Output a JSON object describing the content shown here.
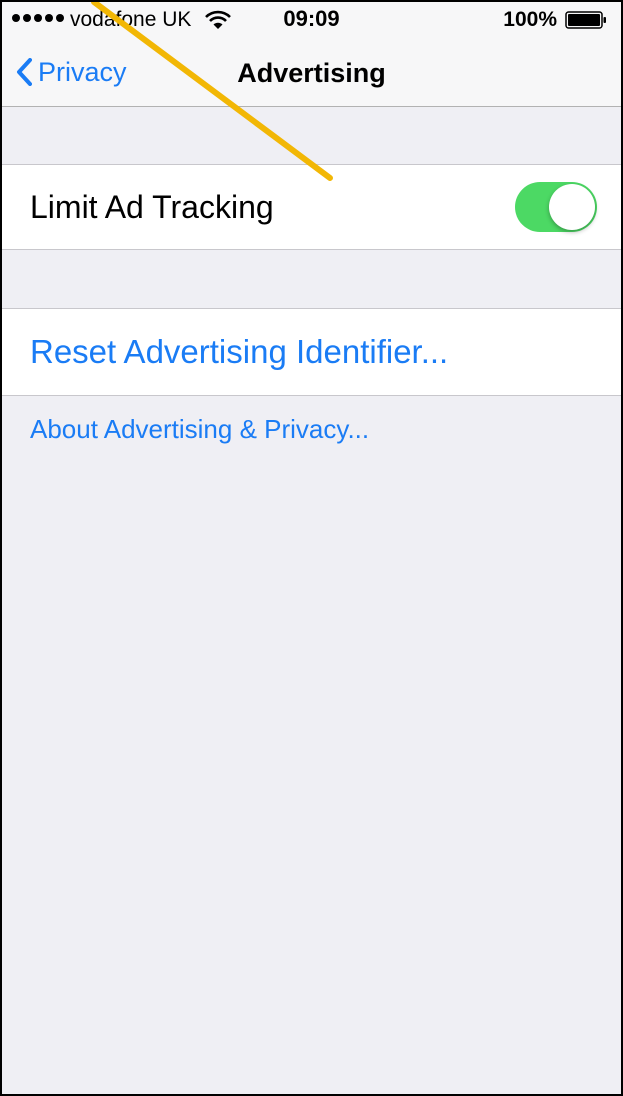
{
  "status_bar": {
    "carrier": "vodafone UK",
    "time": "09:09",
    "battery": "100%"
  },
  "nav": {
    "back_label": "Privacy",
    "title": "Advertising"
  },
  "settings": {
    "limit_ad_tracking": {
      "label": "Limit Ad Tracking",
      "enabled": true
    },
    "reset_label": "Reset Advertising Identifier...",
    "about_label": "About Advertising & Privacy..."
  },
  "colors": {
    "accent": "#1a7cf5",
    "toggle_on": "#4cd964",
    "annotation_arrow": "#f2b705",
    "background": "#efeff4"
  },
  "icons": [
    "signal-dots-icon",
    "wifi-icon",
    "battery-icon",
    "chevron-left-icon"
  ]
}
